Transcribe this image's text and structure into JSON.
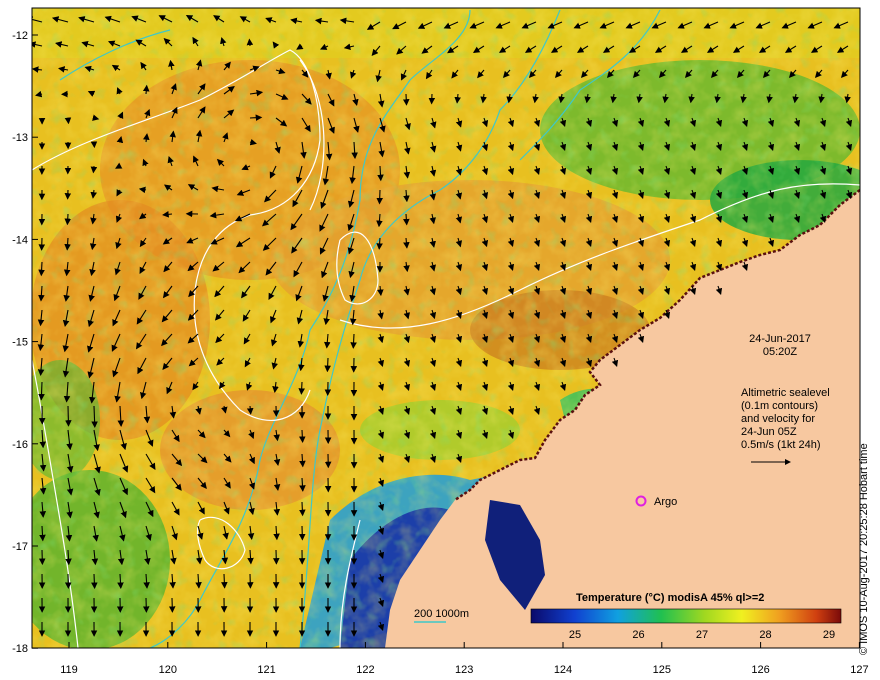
{
  "map": {
    "date": "24-Jun-2017",
    "time": "05:20Z",
    "legend_lines": [
      "Altimetric sealevel",
      "(0.1m contours)",
      "and velocity for",
      "24-Jun 05Z",
      "0.5m/s (1kt 24h)"
    ],
    "argo_label": "Argo",
    "bathy_label": "200  1000m",
    "colorbar_title": "Temperature  (°C) modisA 45% ql>=2",
    "colorbar_ticks": [
      "25",
      "26",
      "27",
      "28",
      "29"
    ],
    "lat_ticks": [
      "-12",
      "-13",
      "-14",
      "-15",
      "-16",
      "-17",
      "-18"
    ],
    "lon_ticks": [
      "119",
      "120",
      "121",
      "122",
      "123",
      "124",
      "125",
      "126",
      "127"
    ],
    "credit": "© IMOS 10-Aug-2017 20:25:28 Hobart time",
    "colors": {
      "land": "#f7c8a0",
      "cold": "#1a2a9a",
      "mid": "#2fbf3a",
      "warm": "#e9a020",
      "contour": "#ffffff",
      "bathy": "#3fc8c8",
      "argo": "#e020e0"
    }
  }
}
